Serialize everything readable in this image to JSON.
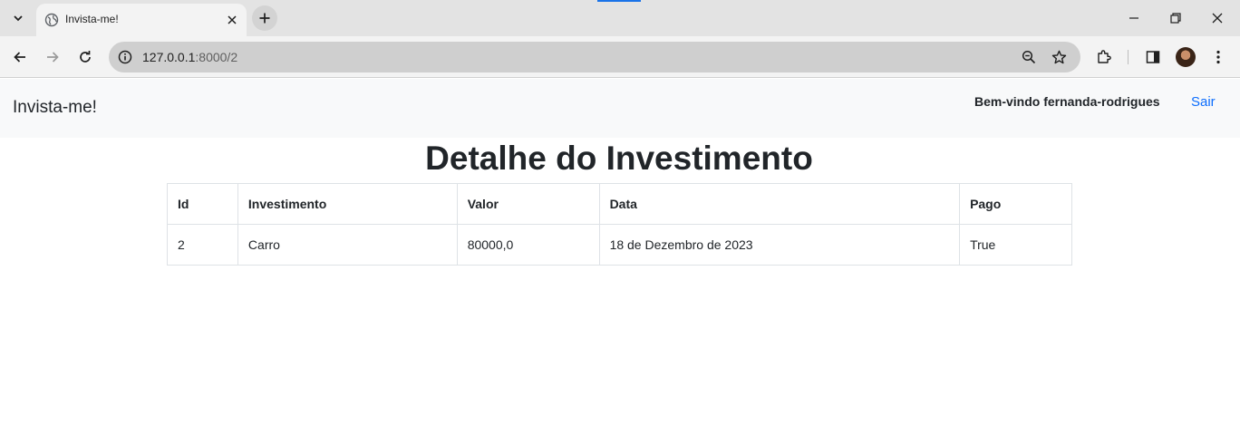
{
  "browser": {
    "tab_title": "Invista-me!",
    "url_host": "127.0.0.1",
    "url_path": ":8000/2"
  },
  "navbar": {
    "brand": "Invista-me!",
    "welcome": "Bem-vindo fernanda-rodrigues",
    "logout": "Sair"
  },
  "page": {
    "title": "Detalhe do Investimento"
  },
  "table": {
    "headers": [
      "Id",
      "Investimento",
      "Valor",
      "Data",
      "Pago"
    ],
    "rows": [
      [
        "2",
        "Carro",
        "80000,0",
        "18 de Dezembro de 2023",
        "True"
      ]
    ]
  },
  "colors": {
    "link": "#0d6efd",
    "navbar_bg": "#f8f9fa",
    "border": "#dee2e6"
  }
}
